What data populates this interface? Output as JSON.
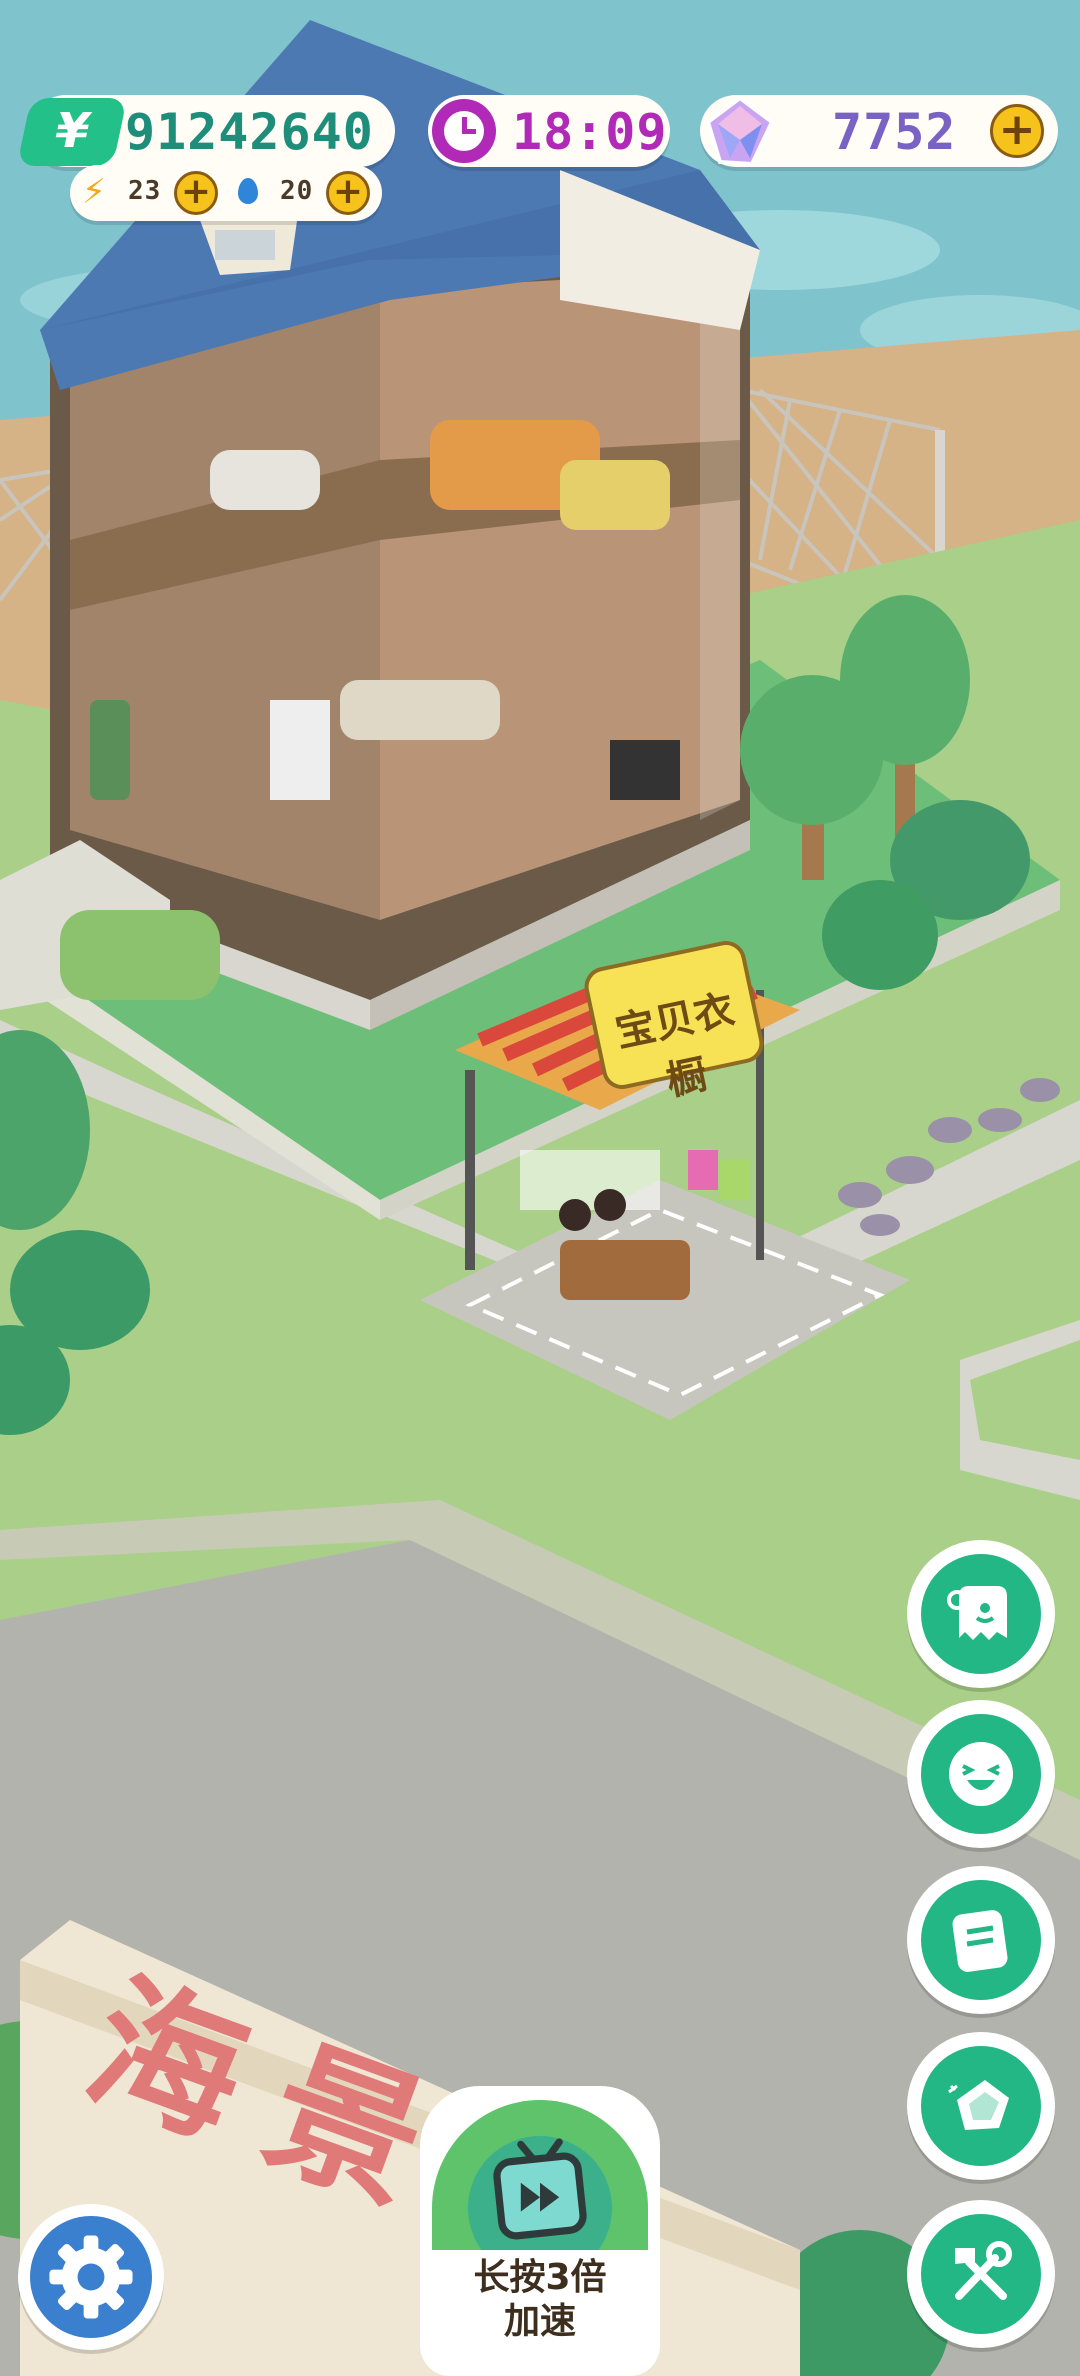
{
  "hud": {
    "money": "91242640",
    "energy": "23",
    "water": "20",
    "clock": "18:09",
    "gems": "7752"
  },
  "shop": {
    "sign": "宝贝衣橱"
  },
  "ground_text": "海景",
  "speed_button": {
    "label": "长按3倍\n加速"
  },
  "side_buttons": [
    {
      "name": "staff-button",
      "icon": "chef-ghost-icon"
    },
    {
      "name": "customer-button",
      "icon": "laughing-face-icon"
    },
    {
      "name": "tasks-button",
      "icon": "notepad-icon"
    },
    {
      "name": "gem-shop-button",
      "icon": "diamond-icon"
    },
    {
      "name": "build-button",
      "icon": "wrench-axe-icon"
    }
  ],
  "colors": {
    "accent_green": "#22b784",
    "money_text": "#1e8d7a",
    "clock_purple": "#b02ab7",
    "gem_text": "#7a62c4",
    "plus_gold": "#f6c21c",
    "settings_blue": "#3b7fcf"
  }
}
